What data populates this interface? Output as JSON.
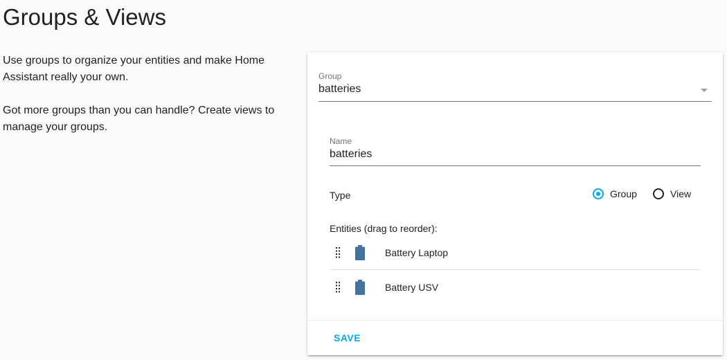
{
  "page": {
    "title": "Groups & Views",
    "intro": [
      "Use groups to organize your entities and make Home Assistant really your own.",
      "Got more groups than you can handle? Create views to manage your groups."
    ]
  },
  "group_select": {
    "label": "Group",
    "value": "batteries"
  },
  "name_field": {
    "label": "Name",
    "value": "batteries"
  },
  "type": {
    "label": "Type",
    "options": [
      {
        "label": "Group",
        "checked": true
      },
      {
        "label": "View",
        "checked": false
      }
    ]
  },
  "entities": {
    "label": "Entities (drag to reorder):",
    "items": [
      {
        "name": "Battery Laptop",
        "icon": "battery-icon"
      },
      {
        "name": "Battery USV",
        "icon": "battery-icon"
      }
    ]
  },
  "actions": {
    "save_label": "SAVE"
  },
  "colors": {
    "accent": "#03a9f4",
    "icon": "#44739e",
    "background": "#fafafa",
    "card": "#ffffff"
  }
}
